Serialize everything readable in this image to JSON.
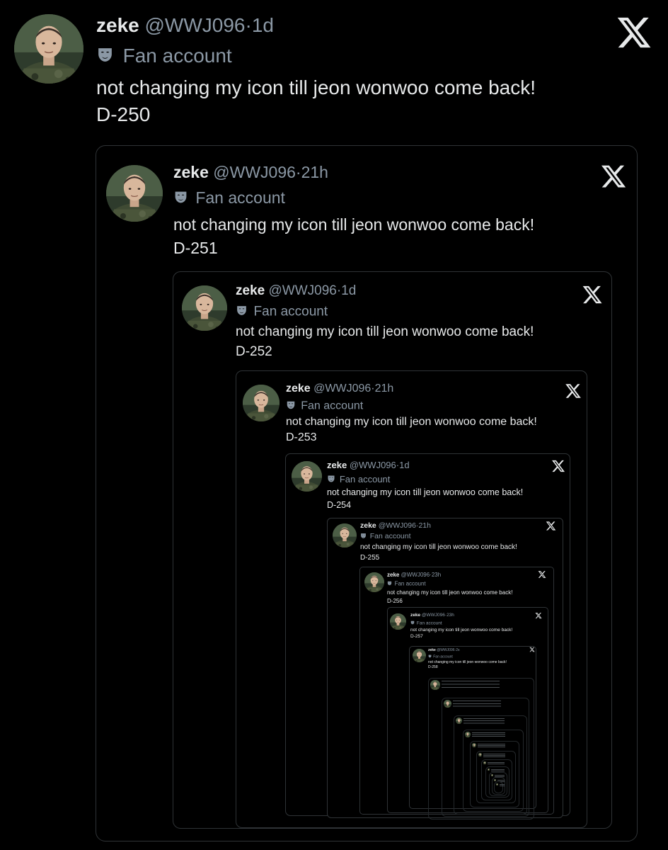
{
  "tweets": [
    {
      "name": "zeke",
      "handle": "@WWJ096",
      "time": "1d",
      "label": "Fan account",
      "text": "not changing my icon till jeon wonwoo come back!",
      "counter": "D-250"
    },
    {
      "name": "zeke",
      "handle": "@WWJ096",
      "time": "21h",
      "label": "Fan account",
      "text": "not changing my icon till jeon wonwoo come back!",
      "counter": "D-251"
    },
    {
      "name": "zeke",
      "handle": "@WWJ096",
      "time": "1d",
      "label": "Fan account",
      "text": "not changing my icon till jeon wonwoo come back!",
      "counter": "D-252"
    },
    {
      "name": "zeke",
      "handle": "@WWJ096",
      "time": "21h",
      "label": "Fan account",
      "text": "not changing my icon till jeon wonwoo come back!",
      "counter": "D-253"
    },
    {
      "name": "zeke",
      "handle": "@WWJ096",
      "time": "1d",
      "label": "Fan account",
      "text": "not changing my icon till jeon wonwoo come back!",
      "counter": "D-254"
    },
    {
      "name": "zeke",
      "handle": "@WWJ096",
      "time": "21h",
      "label": "Fan account",
      "text": "not changing my icon till jeon wonwoo come back!",
      "counter": "D-255"
    },
    {
      "name": "zeke",
      "handle": "@WWJ096",
      "time": "23h",
      "label": "Fan account",
      "text": "not changing my icon till jeon wonwoo come back!",
      "counter": "D-256"
    },
    {
      "name": "zeke",
      "handle": "@WWJ096",
      "time": "23h",
      "label": "Fan account",
      "text": "not changing my icon till jeon wonwoo come back!",
      "counter": "D-257"
    },
    {
      "name": "zeke",
      "handle": "@WWJ096",
      "time": "2s",
      "label": "Fan account",
      "text": "not changing my icon till jeon wonwoo come back!",
      "counter": "D-258"
    }
  ],
  "icons": {
    "brand": "x-logo-icon",
    "label": "theater-mask-icon"
  },
  "colors": {
    "background": "#000000",
    "text": "#e7e9ea",
    "secondary": "#8b98a5",
    "border": "#2f3336"
  }
}
